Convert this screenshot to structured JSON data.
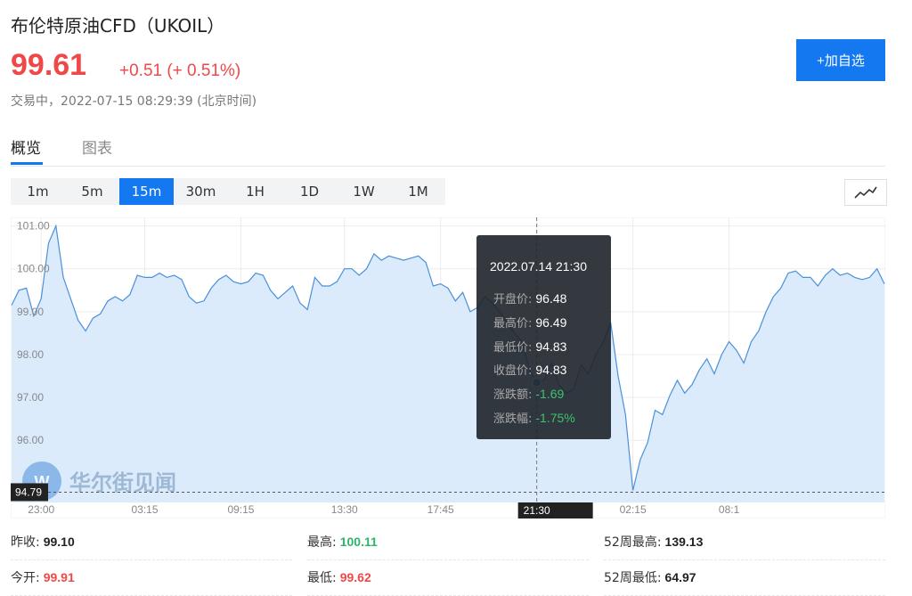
{
  "header": {
    "title": "布伦特原油CFD（UKOIL）",
    "price": "99.61",
    "change": "+0.51 (+ 0.51%)",
    "status": "交易中，2022-07-15 08:29:39 (北京时间)",
    "follow_button": "+加自选"
  },
  "tabs": [
    {
      "label": "概览",
      "active": true
    },
    {
      "label": "图表",
      "active": false
    }
  ],
  "periods": [
    {
      "label": "1m",
      "active": false
    },
    {
      "label": "5m",
      "active": false
    },
    {
      "label": "15m",
      "active": true
    },
    {
      "label": "30m",
      "active": false
    },
    {
      "label": "1H",
      "active": false
    },
    {
      "label": "1D",
      "active": false
    },
    {
      "label": "1W",
      "active": false
    },
    {
      "label": "1M",
      "active": false
    }
  ],
  "chart_type_icon": "line-chart-icon",
  "watermark": "华尔街见闻",
  "colors": {
    "accent": "#1478f0",
    "up": "#f04848",
    "down": "#2db36a",
    "line": "#4a90d9",
    "area": "#dcebfb"
  },
  "chart_data": {
    "type": "area",
    "y_ticks": [
      "101.00",
      "100.00",
      "99.00",
      "98.00",
      "97.00",
      "96.00"
    ],
    "ylim": [
      94.55,
      101.2
    ],
    "x_ticks": [
      "23:00",
      "03:15",
      "09:15",
      "13:30",
      "17:45",
      "21:30",
      "02:15",
      "08:1"
    ],
    "x_tick_index": [
      4,
      18,
      31,
      45,
      58,
      71,
      84,
      97
    ],
    "low_label": "94.79",
    "crosshair_label": "21:30",
    "crosshair_index": 71,
    "grid": true,
    "values": [
      99.15,
      99.5,
      99.55,
      98.9,
      99.3,
      100.6,
      101.0,
      99.8,
      99.3,
      98.8,
      98.55,
      98.85,
      98.95,
      99.25,
      99.35,
      99.25,
      99.4,
      99.85,
      99.8,
      99.8,
      99.9,
      99.8,
      99.85,
      99.75,
      99.35,
      99.2,
      99.25,
      99.55,
      99.75,
      99.85,
      99.7,
      99.65,
      99.7,
      99.9,
      99.85,
      99.5,
      99.3,
      99.45,
      99.6,
      99.2,
      99.05,
      99.8,
      99.6,
      99.6,
      99.7,
      100.0,
      100.0,
      99.85,
      100.0,
      100.35,
      100.2,
      100.3,
      100.25,
      100.2,
      100.25,
      100.3,
      100.15,
      99.6,
      99.65,
      99.55,
      99.25,
      99.45,
      99.0,
      99.1,
      99.35,
      99.2,
      99.0,
      98.75,
      98.5,
      98.3,
      97.65,
      97.35,
      97.4,
      97.8,
      97.3,
      97.1,
      97.2,
      97.75,
      97.55,
      98.0,
      98.3,
      98.75,
      97.5,
      96.6,
      94.83,
      95.55,
      95.95,
      96.7,
      96.6,
      97.05,
      97.4,
      97.1,
      97.3,
      97.65,
      97.9,
      97.55,
      98.0,
      98.3,
      98.1,
      97.8,
      98.3,
      98.55,
      99.0,
      99.35,
      99.55,
      99.9,
      99.95,
      99.8,
      99.8,
      99.6,
      99.85,
      100.0,
      99.85,
      99.9,
      99.8,
      99.75,
      99.8,
      100.0,
      99.65
    ],
    "tooltip": {
      "date": "2022.07.14 21:30",
      "rows": [
        {
          "label": "开盘价:",
          "value": "96.48",
          "tone": "neutral"
        },
        {
          "label": "最高价:",
          "value": "96.49",
          "tone": "neutral"
        },
        {
          "label": "最低价:",
          "value": "94.83",
          "tone": "neutral"
        },
        {
          "label": "收盘价:",
          "value": "94.83",
          "tone": "neutral"
        },
        {
          "label": "涨跌额:",
          "value": "-1.69",
          "tone": "down"
        },
        {
          "label": "涨跌幅:",
          "value": "-1.75%",
          "tone": "down"
        }
      ]
    }
  },
  "stats": [
    {
      "label": "昨收:",
      "value": "99.10",
      "tone": "dark"
    },
    {
      "label": "最高:",
      "value": "100.11",
      "tone": "green"
    },
    {
      "label": "52周最高:",
      "value": "139.13",
      "tone": "dark"
    },
    {
      "label": "今开:",
      "value": "99.91",
      "tone": "red"
    },
    {
      "label": "最低:",
      "value": "99.62",
      "tone": "red"
    },
    {
      "label": "52周最低:",
      "value": "64.97",
      "tone": "dark"
    }
  ]
}
